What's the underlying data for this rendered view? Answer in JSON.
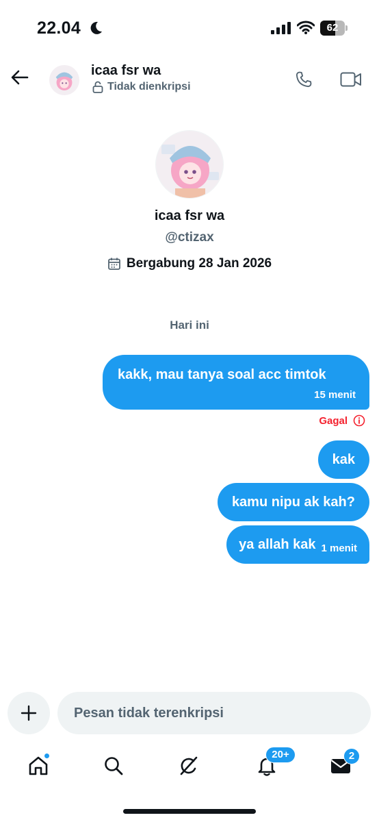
{
  "status_bar": {
    "time": "22.04",
    "battery_level": "62",
    "battery_fraction": 0.62
  },
  "header": {
    "contact_name": "icaa fsr wa",
    "encryption_status": "Tidak dienkripsi"
  },
  "profile": {
    "name": "icaa fsr wa",
    "handle": "@ctizax",
    "joined": "Bergabung 28 Jan 2026"
  },
  "conversation": {
    "date_separator": "Hari ini",
    "messages": [
      {
        "text": "kakk, mau tanya soal acc timtok",
        "time": "15 menit",
        "status": "Gagal"
      },
      {
        "text": "kak"
      },
      {
        "text": "kamu nipu ak kah?"
      },
      {
        "text": "ya allah kak",
        "time": "1 menit"
      }
    ]
  },
  "composer": {
    "placeholder": "Pesan tidak terenkripsi"
  },
  "nav": {
    "notifications_badge": "20+",
    "messages_badge": "2"
  },
  "colors": {
    "accent": "#1d9bf0",
    "error": "#f4212e",
    "secondary_text": "#536471",
    "bubble_text": "#ffffff"
  }
}
